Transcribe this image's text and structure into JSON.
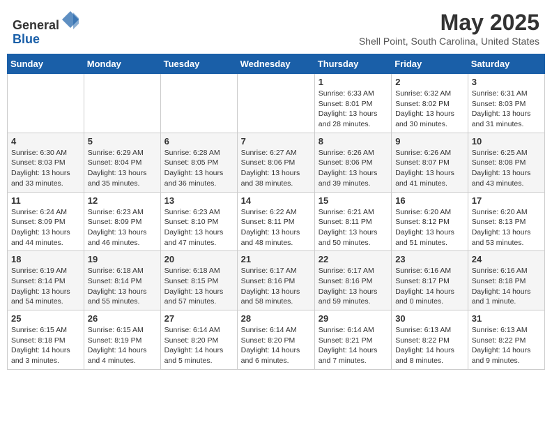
{
  "header": {
    "logo_line1": "General",
    "logo_line2": "Blue",
    "title": "May 2025",
    "subtitle": "Shell Point, South Carolina, United States"
  },
  "weekdays": [
    "Sunday",
    "Monday",
    "Tuesday",
    "Wednesday",
    "Thursday",
    "Friday",
    "Saturday"
  ],
  "weeks": [
    [
      {
        "day": "",
        "info": ""
      },
      {
        "day": "",
        "info": ""
      },
      {
        "day": "",
        "info": ""
      },
      {
        "day": "",
        "info": ""
      },
      {
        "day": "1",
        "info": "Sunrise: 6:33 AM\nSunset: 8:01 PM\nDaylight: 13 hours\nand 28 minutes."
      },
      {
        "day": "2",
        "info": "Sunrise: 6:32 AM\nSunset: 8:02 PM\nDaylight: 13 hours\nand 30 minutes."
      },
      {
        "day": "3",
        "info": "Sunrise: 6:31 AM\nSunset: 8:03 PM\nDaylight: 13 hours\nand 31 minutes."
      }
    ],
    [
      {
        "day": "4",
        "info": "Sunrise: 6:30 AM\nSunset: 8:03 PM\nDaylight: 13 hours\nand 33 minutes."
      },
      {
        "day": "5",
        "info": "Sunrise: 6:29 AM\nSunset: 8:04 PM\nDaylight: 13 hours\nand 35 minutes."
      },
      {
        "day": "6",
        "info": "Sunrise: 6:28 AM\nSunset: 8:05 PM\nDaylight: 13 hours\nand 36 minutes."
      },
      {
        "day": "7",
        "info": "Sunrise: 6:27 AM\nSunset: 8:06 PM\nDaylight: 13 hours\nand 38 minutes."
      },
      {
        "day": "8",
        "info": "Sunrise: 6:26 AM\nSunset: 8:06 PM\nDaylight: 13 hours\nand 39 minutes."
      },
      {
        "day": "9",
        "info": "Sunrise: 6:26 AM\nSunset: 8:07 PM\nDaylight: 13 hours\nand 41 minutes."
      },
      {
        "day": "10",
        "info": "Sunrise: 6:25 AM\nSunset: 8:08 PM\nDaylight: 13 hours\nand 43 minutes."
      }
    ],
    [
      {
        "day": "11",
        "info": "Sunrise: 6:24 AM\nSunset: 8:09 PM\nDaylight: 13 hours\nand 44 minutes."
      },
      {
        "day": "12",
        "info": "Sunrise: 6:23 AM\nSunset: 8:09 PM\nDaylight: 13 hours\nand 46 minutes."
      },
      {
        "day": "13",
        "info": "Sunrise: 6:23 AM\nSunset: 8:10 PM\nDaylight: 13 hours\nand 47 minutes."
      },
      {
        "day": "14",
        "info": "Sunrise: 6:22 AM\nSunset: 8:11 PM\nDaylight: 13 hours\nand 48 minutes."
      },
      {
        "day": "15",
        "info": "Sunrise: 6:21 AM\nSunset: 8:11 PM\nDaylight: 13 hours\nand 50 minutes."
      },
      {
        "day": "16",
        "info": "Sunrise: 6:20 AM\nSunset: 8:12 PM\nDaylight: 13 hours\nand 51 minutes."
      },
      {
        "day": "17",
        "info": "Sunrise: 6:20 AM\nSunset: 8:13 PM\nDaylight: 13 hours\nand 53 minutes."
      }
    ],
    [
      {
        "day": "18",
        "info": "Sunrise: 6:19 AM\nSunset: 8:14 PM\nDaylight: 13 hours\nand 54 minutes."
      },
      {
        "day": "19",
        "info": "Sunrise: 6:18 AM\nSunset: 8:14 PM\nDaylight: 13 hours\nand 55 minutes."
      },
      {
        "day": "20",
        "info": "Sunrise: 6:18 AM\nSunset: 8:15 PM\nDaylight: 13 hours\nand 57 minutes."
      },
      {
        "day": "21",
        "info": "Sunrise: 6:17 AM\nSunset: 8:16 PM\nDaylight: 13 hours\nand 58 minutes."
      },
      {
        "day": "22",
        "info": "Sunrise: 6:17 AM\nSunset: 8:16 PM\nDaylight: 13 hours\nand 59 minutes."
      },
      {
        "day": "23",
        "info": "Sunrise: 6:16 AM\nSunset: 8:17 PM\nDaylight: 14 hours\nand 0 minutes."
      },
      {
        "day": "24",
        "info": "Sunrise: 6:16 AM\nSunset: 8:18 PM\nDaylight: 14 hours\nand 1 minute."
      }
    ],
    [
      {
        "day": "25",
        "info": "Sunrise: 6:15 AM\nSunset: 8:18 PM\nDaylight: 14 hours\nand 3 minutes."
      },
      {
        "day": "26",
        "info": "Sunrise: 6:15 AM\nSunset: 8:19 PM\nDaylight: 14 hours\nand 4 minutes."
      },
      {
        "day": "27",
        "info": "Sunrise: 6:14 AM\nSunset: 8:20 PM\nDaylight: 14 hours\nand 5 minutes."
      },
      {
        "day": "28",
        "info": "Sunrise: 6:14 AM\nSunset: 8:20 PM\nDaylight: 14 hours\nand 6 minutes."
      },
      {
        "day": "29",
        "info": "Sunrise: 6:14 AM\nSunset: 8:21 PM\nDaylight: 14 hours\nand 7 minutes."
      },
      {
        "day": "30",
        "info": "Sunrise: 6:13 AM\nSunset: 8:22 PM\nDaylight: 14 hours\nand 8 minutes."
      },
      {
        "day": "31",
        "info": "Sunrise: 6:13 AM\nSunset: 8:22 PM\nDaylight: 14 hours\nand 9 minutes."
      }
    ]
  ]
}
